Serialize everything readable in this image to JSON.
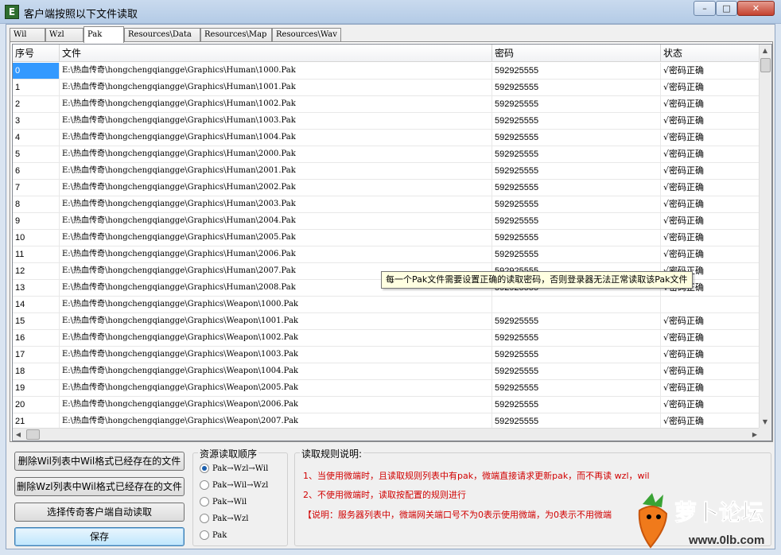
{
  "window": {
    "app_icon_letter": "E",
    "title": "客户端按照以下文件读取",
    "min_glyph": "–",
    "max_glyph": "□",
    "close_glyph": "✕"
  },
  "tabs": [
    {
      "label": "Wil",
      "active": false
    },
    {
      "label": "Wzl",
      "active": false
    },
    {
      "label": "Pak",
      "active": true
    },
    {
      "label": "Resources\\Data",
      "active": false
    },
    {
      "label": "Resources\\Map",
      "active": false
    },
    {
      "label": "Resources\\Wav",
      "active": false
    }
  ],
  "grid": {
    "columns": [
      "序号",
      "文件",
      "密码",
      "状态"
    ],
    "rows": [
      {
        "index": "0",
        "file": "E:\\热血传奇\\hongchengqiangge\\Graphics\\Human\\1000.Pak",
        "password": "592925555",
        "status": "√密码正确"
      },
      {
        "index": "1",
        "file": "E:\\热血传奇\\hongchengqiangge\\Graphics\\Human\\1001.Pak",
        "password": "592925555",
        "status": "√密码正确"
      },
      {
        "index": "2",
        "file": "E:\\热血传奇\\hongchengqiangge\\Graphics\\Human\\1002.Pak",
        "password": "592925555",
        "status": "√密码正确"
      },
      {
        "index": "3",
        "file": "E:\\热血传奇\\hongchengqiangge\\Graphics\\Human\\1003.Pak",
        "password": "592925555",
        "status": "√密码正确"
      },
      {
        "index": "4",
        "file": "E:\\热血传奇\\hongchengqiangge\\Graphics\\Human\\1004.Pak",
        "password": "592925555",
        "status": "√密码正确"
      },
      {
        "index": "5",
        "file": "E:\\热血传奇\\hongchengqiangge\\Graphics\\Human\\2000.Pak",
        "password": "592925555",
        "status": "√密码正确"
      },
      {
        "index": "6",
        "file": "E:\\热血传奇\\hongchengqiangge\\Graphics\\Human\\2001.Pak",
        "password": "592925555",
        "status": "√密码正确"
      },
      {
        "index": "7",
        "file": "E:\\热血传奇\\hongchengqiangge\\Graphics\\Human\\2002.Pak",
        "password": "592925555",
        "status": "√密码正确"
      },
      {
        "index": "8",
        "file": "E:\\热血传奇\\hongchengqiangge\\Graphics\\Human\\2003.Pak",
        "password": "592925555",
        "status": "√密码正确"
      },
      {
        "index": "9",
        "file": "E:\\热血传奇\\hongchengqiangge\\Graphics\\Human\\2004.Pak",
        "password": "592925555",
        "status": "√密码正确"
      },
      {
        "index": "10",
        "file": "E:\\热血传奇\\hongchengqiangge\\Graphics\\Human\\2005.Pak",
        "password": "592925555",
        "status": "√密码正确"
      },
      {
        "index": "11",
        "file": "E:\\热血传奇\\hongchengqiangge\\Graphics\\Human\\2006.Pak",
        "password": "592925555",
        "status": "√密码正确"
      },
      {
        "index": "12",
        "file": "E:\\热血传奇\\hongchengqiangge\\Graphics\\Human\\2007.Pak",
        "password": "592925555",
        "status": "√密码正确"
      },
      {
        "index": "13",
        "file": "E:\\热血传奇\\hongchengqiangge\\Graphics\\Human\\2008.Pak",
        "password": "592925555",
        "status": "√密码正确"
      },
      {
        "index": "14",
        "file": "E:\\热血传奇\\hongchengqiangge\\Graphics\\Weapon\\1000.Pak",
        "password": "",
        "status": ""
      },
      {
        "index": "15",
        "file": "E:\\热血传奇\\hongchengqiangge\\Graphics\\Weapon\\1001.Pak",
        "password": "592925555",
        "status": "√密码正确"
      },
      {
        "index": "16",
        "file": "E:\\热血传奇\\hongchengqiangge\\Graphics\\Weapon\\1002.Pak",
        "password": "592925555",
        "status": "√密码正确"
      },
      {
        "index": "17",
        "file": "E:\\热血传奇\\hongchengqiangge\\Graphics\\Weapon\\1003.Pak",
        "password": "592925555",
        "status": "√密码正确"
      },
      {
        "index": "18",
        "file": "E:\\热血传奇\\hongchengqiangge\\Graphics\\Weapon\\1004.Pak",
        "password": "592925555",
        "status": "√密码正确"
      },
      {
        "index": "19",
        "file": "E:\\热血传奇\\hongchengqiangge\\Graphics\\Weapon\\2005.Pak",
        "password": "592925555",
        "status": "√密码正确"
      },
      {
        "index": "20",
        "file": "E:\\热血传奇\\hongchengqiangge\\Graphics\\Weapon\\2006.Pak",
        "password": "592925555",
        "status": "√密码正确"
      },
      {
        "index": "21",
        "file": "E:\\热血传奇\\hongchengqiangge\\Graphics\\Weapon\\2007.Pak",
        "password": "592925555",
        "status": "√密码正确"
      }
    ],
    "selected_row": 0
  },
  "tooltip": "每一个Pak文件需要设置正确的读取密码，否则登录器无法正常读取该Pak文件",
  "buttons": {
    "delete_wil": "删除Wil列表中Wil格式已经存在的文件",
    "delete_wzl": "删除Wzl列表中Wil格式已经存在的文件",
    "auto_read": "选择传奇客户端自动读取",
    "save": "保存"
  },
  "order_group": {
    "title": "资源读取顺序",
    "options": [
      {
        "label": "Pak→Wzl→Wil",
        "selected": true
      },
      {
        "label": "Pak→Wil→Wzl",
        "selected": false
      },
      {
        "label": "Pak→Wil",
        "selected": false
      },
      {
        "label": "Pak→Wzl",
        "selected": false
      },
      {
        "label": "Pak",
        "selected": false
      }
    ]
  },
  "rules_group": {
    "title": "读取规则说明:",
    "lines": [
      "1、当使用微端时，且读取规则列表中有pak，微端直接请求更新pak，而不再读 wzl，wil",
      "2、不使用微端时，读取按配置的规则进行",
      "【说明：服务器列表中，微端网关端口号不为0表示使用微端，为0表示不用微端"
    ]
  },
  "watermark": {
    "text": "萝卜论坛",
    "url": "www.0lb.com"
  },
  "colors": {
    "selection": "#3399ff",
    "rule_text": "#d10000",
    "tooltip_bg": "#ffffe1"
  }
}
